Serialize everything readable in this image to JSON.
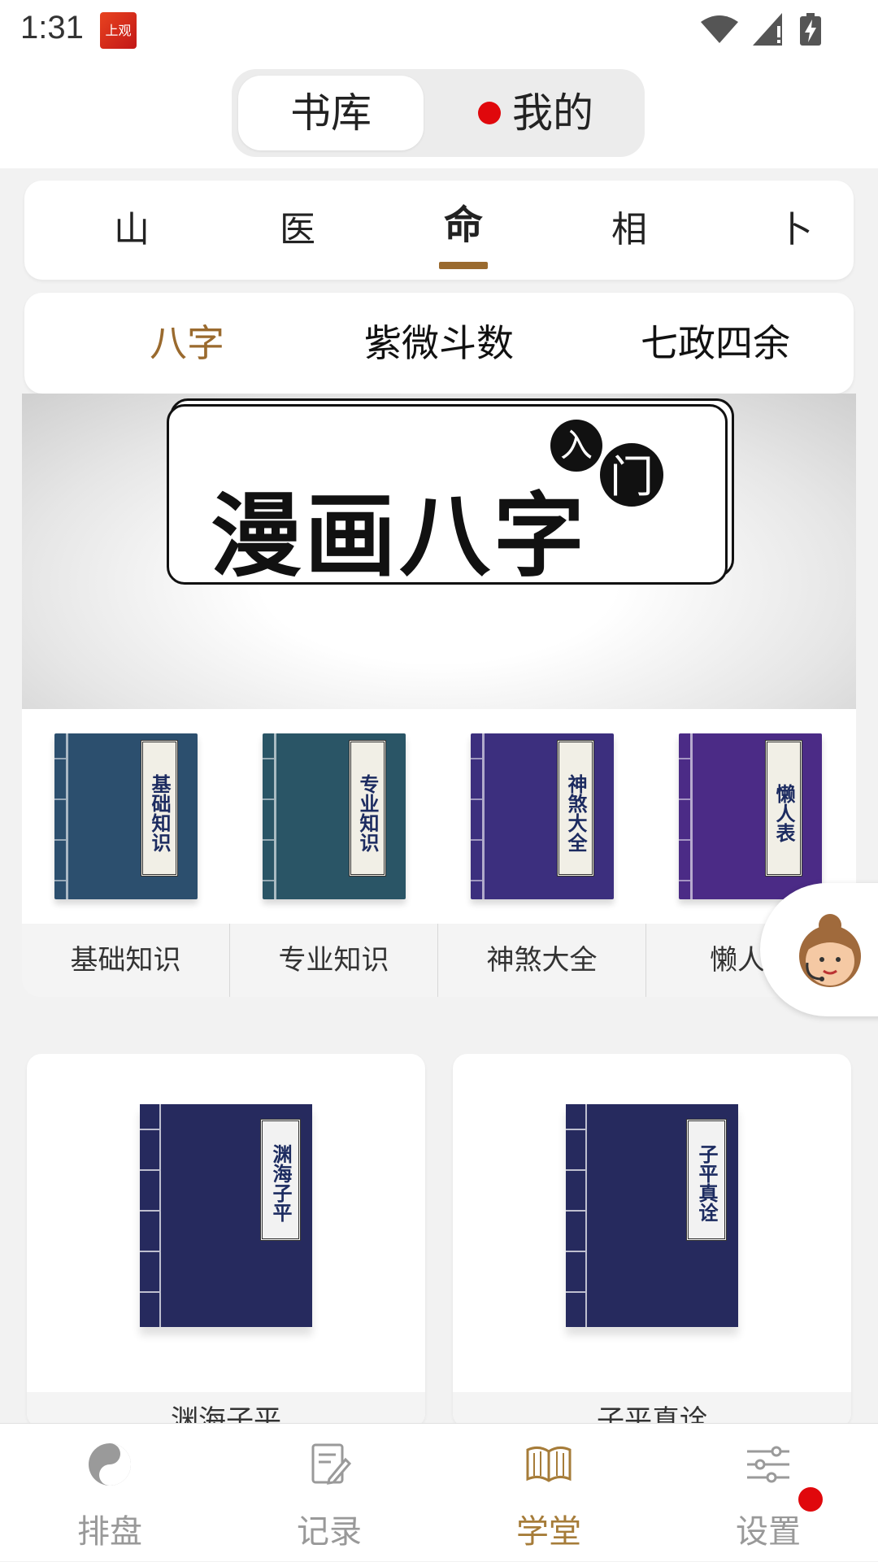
{
  "status_bar": {
    "time": "1:31",
    "app_icon_text": "上观"
  },
  "segment": {
    "library": "书库",
    "mine": "我的"
  },
  "category_tabs": [
    "山",
    "医",
    "命",
    "相",
    "卜"
  ],
  "sub_tabs": [
    "八字",
    "紫微斗数",
    "七政四余"
  ],
  "banner": {
    "title": "漫画八字",
    "badge1": "入",
    "badge2": "门"
  },
  "books": [
    {
      "label": "基础知识",
      "color": "#2c4f6e"
    },
    {
      "label": "专业知识",
      "color": "#2a5566"
    },
    {
      "label": "神煞大全",
      "color": "#3c2f7e"
    },
    {
      "label": "懒人表",
      "color": "#4b2b86"
    }
  ],
  "book_categories": [
    "基础知识",
    "专业知识",
    "神煞大全",
    "懒人"
  ],
  "featured": [
    {
      "label": "渊海子平",
      "caption": "渊海子平"
    },
    {
      "label": "子平真诠",
      "caption": "子平真诠"
    }
  ],
  "tabbar": [
    {
      "label": "排盘",
      "icon": "yin-yang-icon"
    },
    {
      "label": "记录",
      "icon": "notes-icon"
    },
    {
      "label": "学堂",
      "icon": "book-icon"
    },
    {
      "label": "设置",
      "icon": "sliders-icon"
    }
  ],
  "colors": {
    "accent": "#9a6a2e",
    "notification": "#e0080c"
  }
}
